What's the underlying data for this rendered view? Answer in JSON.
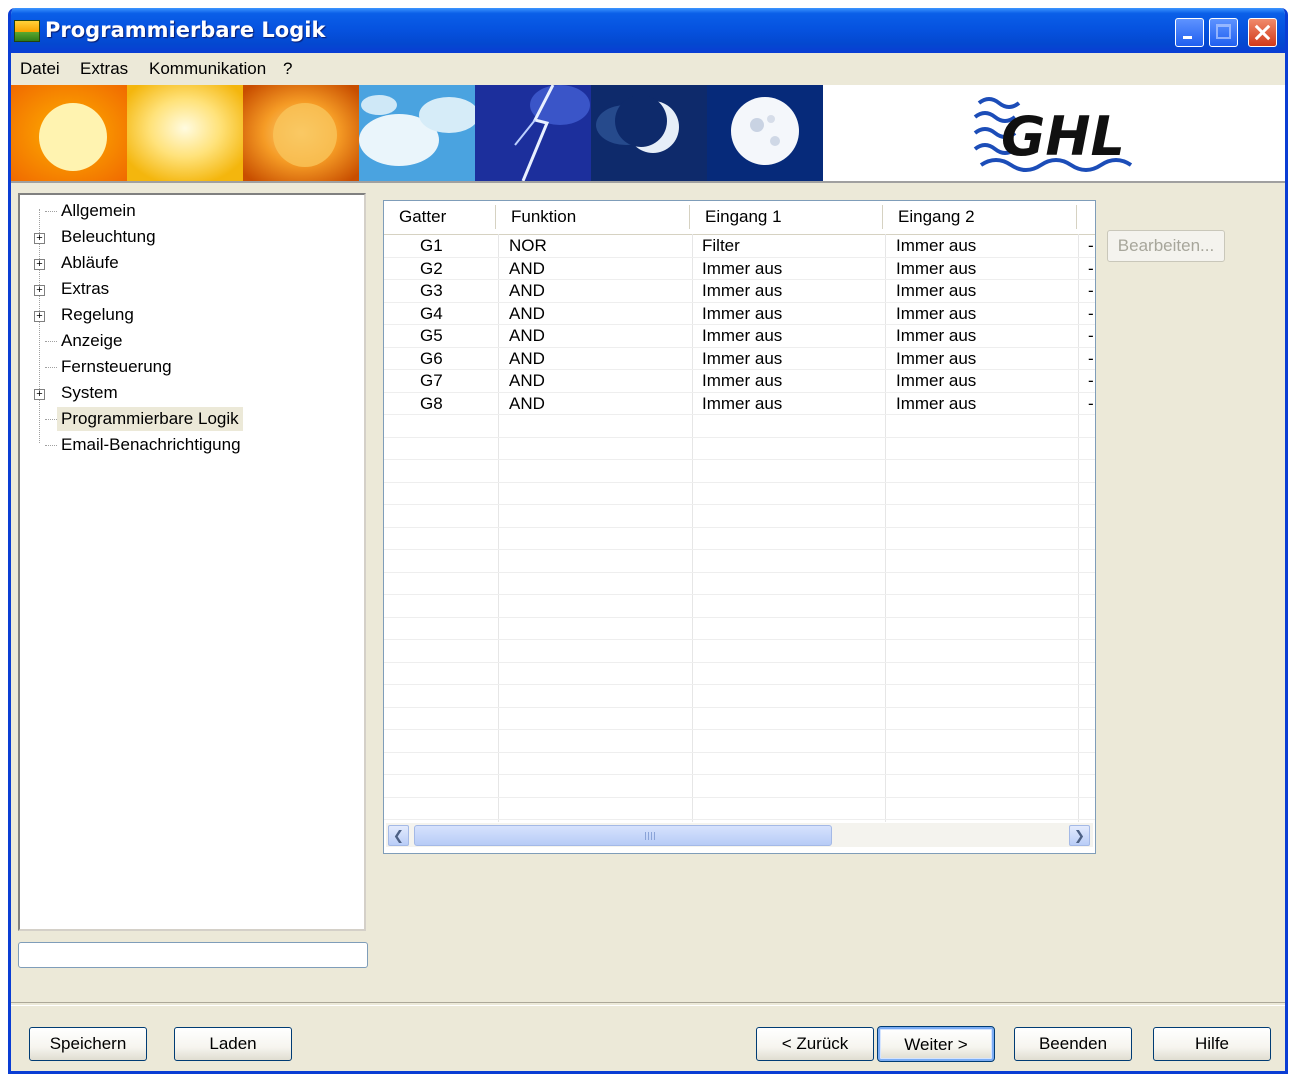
{
  "window": {
    "title": "Programmierbare Logik"
  },
  "menu": [
    "Datei",
    "Extras",
    "Kommunikation",
    "?"
  ],
  "logo": {
    "text": "GHL"
  },
  "tree": [
    {
      "label": "Allgemein",
      "expandable": false
    },
    {
      "label": "Beleuchtung",
      "expandable": true
    },
    {
      "label": "Abläufe",
      "expandable": true
    },
    {
      "label": "Extras",
      "expandable": true
    },
    {
      "label": "Regelung",
      "expandable": true
    },
    {
      "label": "Anzeige",
      "expandable": false
    },
    {
      "label": "Fernsteuerung",
      "expandable": false
    },
    {
      "label": "System",
      "expandable": true
    },
    {
      "label": "Programmierbare Logik",
      "expandable": false,
      "selected": true
    },
    {
      "label": "Email-Benachrichtigung",
      "expandable": false
    }
  ],
  "grid": {
    "columns": [
      "Gatter",
      "Funktion",
      "Eingang 1",
      "Eingang 2"
    ],
    "rows": [
      [
        "G1",
        "NOR",
        "Filter",
        "Immer aus"
      ],
      [
        "G2",
        "AND",
        "Immer aus",
        "Immer aus"
      ],
      [
        "G3",
        "AND",
        "Immer aus",
        "Immer aus"
      ],
      [
        "G4",
        "AND",
        "Immer aus",
        "Immer aus"
      ],
      [
        "G5",
        "AND",
        "Immer aus",
        "Immer aus"
      ],
      [
        "G6",
        "AND",
        "Immer aus",
        "Immer aus"
      ],
      [
        "G7",
        "AND",
        "Immer aus",
        "Immer aus"
      ],
      [
        "G8",
        "AND",
        "Immer aus",
        "Immer aus"
      ]
    ],
    "trailing_marker": "-"
  },
  "buttons": {
    "edit": "Bearbeiten...",
    "save": "Speichern",
    "load": "Laden",
    "back": "< Zurück",
    "next": "Weiter >",
    "quit": "Beenden",
    "help": "Hilfe"
  }
}
